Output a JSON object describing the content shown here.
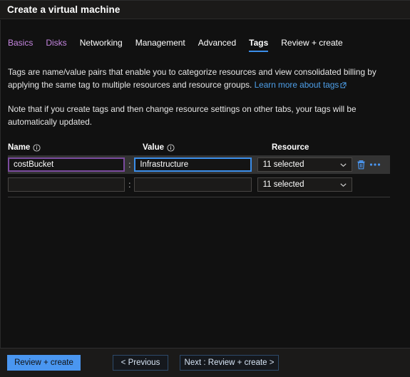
{
  "window": {
    "title": "Create a virtual machine"
  },
  "tabs": [
    {
      "label": "Basics",
      "state": "visited"
    },
    {
      "label": "Disks",
      "state": "visited"
    },
    {
      "label": "Networking",
      "state": "normal"
    },
    {
      "label": "Management",
      "state": "normal"
    },
    {
      "label": "Advanced",
      "state": "normal"
    },
    {
      "label": "Tags",
      "state": "active"
    },
    {
      "label": "Review + create",
      "state": "normal"
    }
  ],
  "description": {
    "line1_before_link": "Tags are name/value pairs that enable you to categorize resources and view consolidated billing by applying the same tag to multiple resources and resource groups. ",
    "link_text": "Learn more about tags",
    "line2": "Note that if you create tags and then change resource settings on other tabs, your tags will be automatically updated."
  },
  "table": {
    "headers": {
      "name": "Name",
      "value": "Value",
      "resource": "Resource"
    },
    "separator": ":",
    "rows": [
      {
        "name": "costBucket",
        "name_placeholder": "",
        "value": "Infrastructure",
        "value_placeholder": "",
        "resource": "11 selected",
        "hovered": true,
        "has_actions": true
      },
      {
        "name": "",
        "name_placeholder": "",
        "value": "",
        "value_placeholder": "",
        "resource": "11 selected",
        "hovered": false,
        "has_actions": false
      }
    ]
  },
  "footer": {
    "review_create": "Review + create",
    "previous": "< Previous",
    "next": "Next : Review + create >"
  },
  "colors": {
    "accent_blue": "#4a96f0",
    "tab_active_underline": "#3b8eea",
    "tab_visited": "#c586e0",
    "link_blue": "#4ea0ea",
    "input_focus": "#3b8eea",
    "input_purple": "#7b4b9e",
    "background": "#111111",
    "chrome": "#1b1a19"
  }
}
